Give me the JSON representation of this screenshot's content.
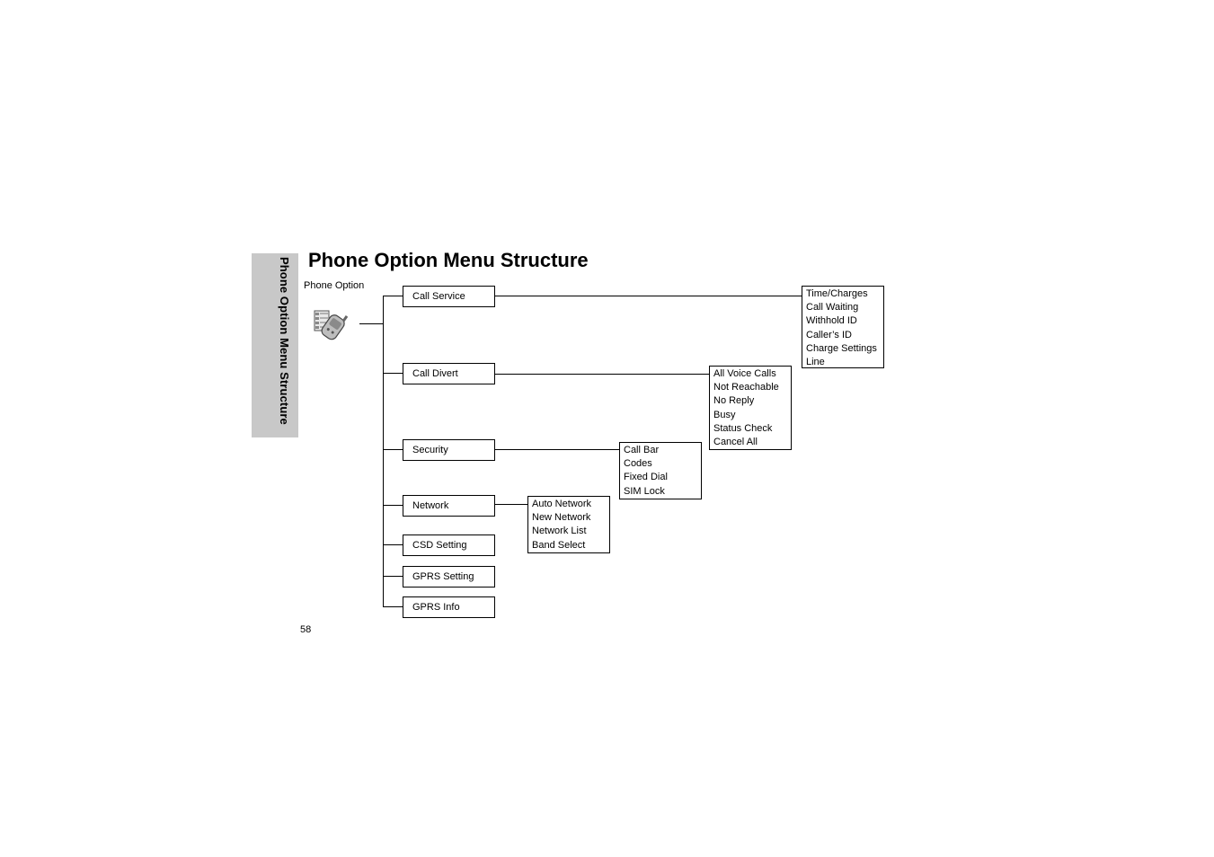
{
  "page": {
    "side_tab": "Phone Option Menu Structure",
    "title": "Phone Option Menu Structure",
    "page_number": "58"
  },
  "diagram": {
    "root": {
      "label": "Phone Option",
      "icon": "phone-settings-icon"
    },
    "menu_items": [
      {
        "label": "Call Service",
        "submenu": [
          "Time/Charges",
          "Call Waiting",
          "Withhold ID",
          "Caller’s ID",
          "Charge Settings",
          "Line"
        ]
      },
      {
        "label": "Call Divert",
        "submenu": [
          "All Voice Calls",
          "Not Reachable",
          "No Reply",
          "Busy",
          "Status Check",
          "Cancel All"
        ]
      },
      {
        "label": "Security",
        "submenu": [
          "Call Bar",
          "Codes",
          "Fixed Dial",
          "SIM Lock"
        ]
      },
      {
        "label": "Network",
        "submenu": [
          "Auto Network",
          "New Network",
          "Network List",
          "Band Select"
        ]
      },
      {
        "label": "CSD Setting",
        "submenu": []
      },
      {
        "label": "GPRS Setting",
        "submenu": []
      },
      {
        "label": "GPRS Info",
        "submenu": []
      }
    ]
  }
}
